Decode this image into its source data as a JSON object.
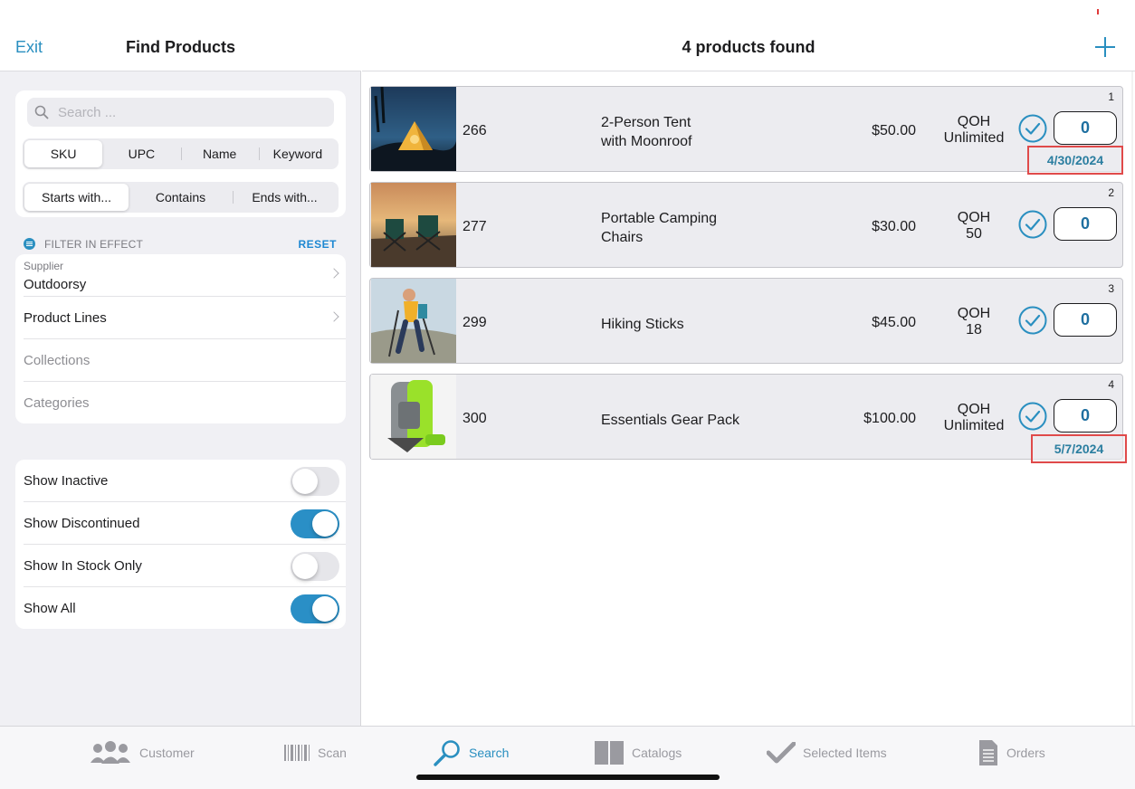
{
  "left_header": {
    "exit_label": "Exit",
    "title": "Find Products"
  },
  "search": {
    "placeholder": "Search ...",
    "field_options": [
      "SKU",
      "UPC",
      "Name",
      "Keyword"
    ],
    "field_selected": "SKU",
    "match_options": [
      "Starts with...",
      "Contains",
      "Ends with..."
    ],
    "match_selected": "Starts with..."
  },
  "filter": {
    "label": "FILTER IN EFFECT",
    "reset_label": "RESET",
    "supplier_label": "Supplier",
    "supplier_value": "Outdoorsy",
    "product_lines": "Product Lines",
    "collections": "Collections",
    "categories": "Categories"
  },
  "toggles": [
    {
      "label": "Show Inactive",
      "on": false
    },
    {
      "label": "Show Discontinued",
      "on": true
    },
    {
      "label": "Show In Stock Only",
      "on": false
    },
    {
      "label": "Show All",
      "on": true
    }
  ],
  "results": {
    "title": "4 products found",
    "products": [
      {
        "index": "1",
        "sku": "266",
        "name_line1": "2-Person Tent",
        "name_line2": "with Moonroof",
        "price": "$50.00",
        "qoh_label": "QOH",
        "qoh_value": "Unlimited",
        "qty": "0",
        "date": "4/30/2024"
      },
      {
        "index": "2",
        "sku": "277",
        "name_line1": "Portable Camping",
        "name_line2": "Chairs",
        "price": "$30.00",
        "qoh_label": "QOH",
        "qoh_value": "50",
        "qty": "0",
        "date": ""
      },
      {
        "index": "3",
        "sku": "299",
        "name_line1": "Hiking Sticks",
        "name_line2": "",
        "price": "$45.00",
        "qoh_label": "QOH",
        "qoh_value": "18",
        "qty": "0",
        "date": ""
      },
      {
        "index": "4",
        "sku": "300",
        "name_line1": "Essentials Gear Pack",
        "name_line2": "",
        "price": "$100.00",
        "qoh_label": "QOH",
        "qoh_value": "Unlimited",
        "qty": "0",
        "date": "5/7/2024"
      }
    ]
  },
  "tabbar": {
    "active": "Search",
    "items": [
      {
        "label": "Customer",
        "icon": "people-icon"
      },
      {
        "label": "Scan",
        "icon": "barcode-icon"
      },
      {
        "label": "Search",
        "icon": "magnifier-icon"
      },
      {
        "label": "Catalogs",
        "icon": "book-icon"
      },
      {
        "label": "Selected Items",
        "icon": "checkmark-icon"
      },
      {
        "label": "Orders",
        "icon": "document-icon"
      }
    ]
  },
  "colors": {
    "accent": "#2a8fc0",
    "highlight_border": "#e04a4a",
    "toggle_on": "#2a8fc6"
  }
}
